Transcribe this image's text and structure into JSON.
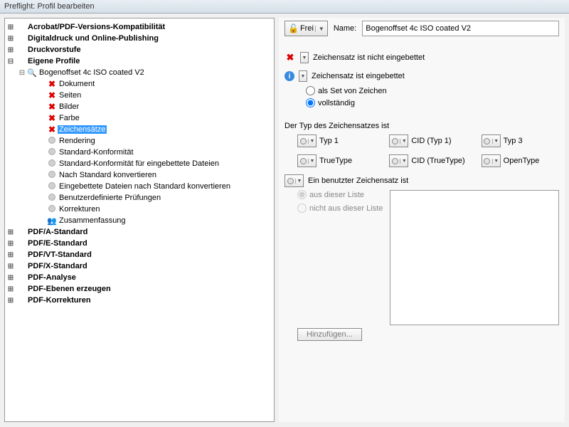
{
  "window": {
    "title": "Preflight: Profil bearbeiten"
  },
  "tree": {
    "roots": [
      {
        "label": "Acrobat/PDF-Versions-Kompatibilität",
        "exp": "closed"
      },
      {
        "label": "Digitaldruck und Online-Publishing",
        "exp": "closed"
      },
      {
        "label": "Druckvorstufe",
        "exp": "closed"
      },
      {
        "label": "Eigene Profile",
        "exp": "open",
        "children": [
          {
            "label": "Bogenoffset 4c ISO coated V2",
            "icon": "magnifier",
            "exp": "open",
            "children": [
              {
                "label": "Dokument",
                "icon": "error"
              },
              {
                "label": "Seiten",
                "icon": "error"
              },
              {
                "label": "Bilder",
                "icon": "error"
              },
              {
                "label": "Farbe",
                "icon": "error"
              },
              {
                "label": "Zeichensätze",
                "icon": "error",
                "selected": true
              },
              {
                "label": "Rendering",
                "icon": "idle"
              },
              {
                "label": "Standard-Konformität",
                "icon": "idle"
              },
              {
                "label": "Standard-Konformität für eingebettete Dateien",
                "icon": "idle"
              },
              {
                "label": "Nach Standard konvertieren",
                "icon": "idle"
              },
              {
                "label": "Eingebettete Dateien nach Standard konvertieren",
                "icon": "idle"
              },
              {
                "label": "Benutzerdefinierte Prüfungen",
                "icon": "idle"
              },
              {
                "label": "Korrekturen",
                "icon": "idle"
              },
              {
                "label": "Zusammenfassung",
                "icon": "summary"
              }
            ]
          }
        ]
      },
      {
        "label": "PDF/A-Standard",
        "exp": "closed"
      },
      {
        "label": "PDF/E-Standard",
        "exp": "closed"
      },
      {
        "label": "PDF/VT-Standard",
        "exp": "closed"
      },
      {
        "label": "PDF/X-Standard",
        "exp": "closed"
      },
      {
        "label": "PDF-Analyse",
        "exp": "closed"
      },
      {
        "label": "PDF-Ebenen erzeugen",
        "exp": "closed"
      },
      {
        "label": "PDF-Korrekturen",
        "exp": "closed"
      }
    ]
  },
  "right": {
    "lock_label": "Frei",
    "name_label": "Name:",
    "name_value": "Bogenoffset 4c ISO coated V2",
    "check_not_embedded": "Zeichensatz ist nicht eingebettet",
    "check_embedded": "Zeichensatz ist eingebettet",
    "radio_subset": "als Set von Zeichen",
    "radio_full": "vollständig",
    "type_header": "Der Typ des Zeichensatzes ist",
    "types": [
      "Typ 1",
      "CID (Typ 1)",
      "Typ 3",
      "TrueType",
      "CID (TrueType)",
      "OpenType"
    ],
    "used_header": "Ein benutzter Zeichensatz ist",
    "radio_from_list": "aus dieser Liste",
    "radio_not_from_list": "nicht aus dieser Liste",
    "add_button": "Hinzufügen..."
  }
}
